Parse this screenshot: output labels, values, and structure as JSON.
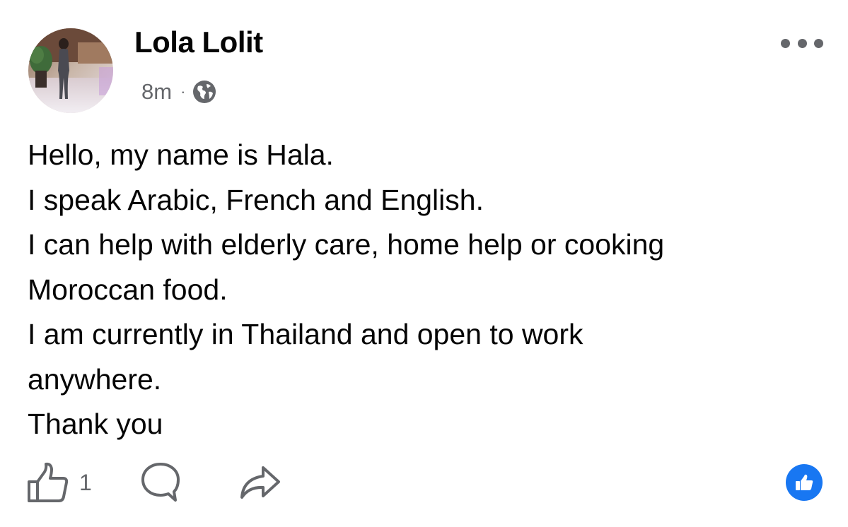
{
  "post": {
    "author": "Lola Lolit",
    "timestamp": "8m",
    "separator": "·",
    "audience_icon": "globe-icon",
    "menu_icon": "more-horizontal-icon",
    "text_lines": [
      "Hello, my name is Hala.",
      "I speak Arabic, French and English.",
      "I can help with elderly care, home help or cooking",
      "Moroccan food.",
      "I am currently in Thailand and open to work",
      "anywhere.",
      "Thank you"
    ]
  },
  "actions": {
    "like_icon": "thumbs-up-outline-icon",
    "like_count": "1",
    "comment_icon": "comment-bubble-icon",
    "share_icon": "share-arrow-icon",
    "reaction_badge_icon": "like-reaction-icon"
  },
  "colors": {
    "text": "#050505",
    "secondary_text": "#65676b",
    "brand_blue": "#1877f2",
    "background": "#ffffff"
  }
}
